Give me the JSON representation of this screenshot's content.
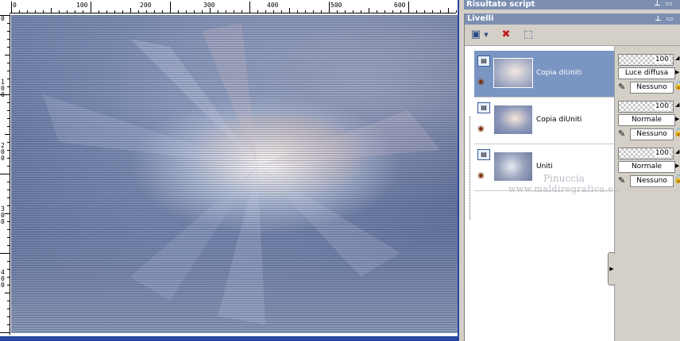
{
  "ruler": {
    "top_labels": [
      "0",
      "100",
      "200",
      "300",
      "400",
      "500",
      "600"
    ],
    "left_labels": [
      "0",
      "1\n0\n0",
      "2\n0\n0",
      "3\n0\n0",
      "4\n0\n0"
    ]
  },
  "script_panel": {
    "title": "Risultato script"
  },
  "layers_panel": {
    "title": "Livelli",
    "layers": [
      {
        "name": "Copia diUniti",
        "selected": true,
        "opacity": "100",
        "blend_mode": "Luce diffusa",
        "mask": "Nessuno"
      },
      {
        "name": "Copia diUniti",
        "selected": false,
        "opacity": "100",
        "blend_mode": "Normale",
        "mask": "Nessuno"
      },
      {
        "name": "Uniti",
        "selected": false,
        "opacity": "100",
        "blend_mode": "Normale",
        "mask": "Nessuno"
      }
    ]
  },
  "watermark": {
    "line1": "Pinuccia",
    "line2": "www.maldiregrafica.eu"
  },
  "colors": {
    "titlebar": "#7c8fb2",
    "selected_layer": "#7a95c2",
    "canvas_border": "#2847a0"
  }
}
